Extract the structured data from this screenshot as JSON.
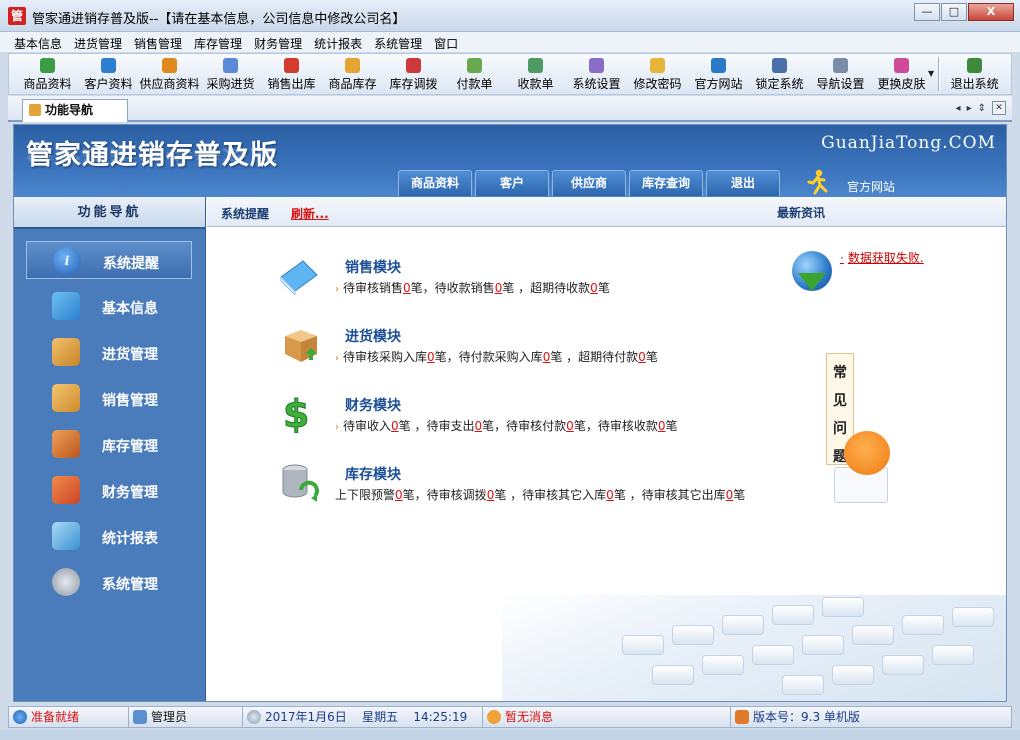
{
  "window": {
    "app_icon_char": "管",
    "title": "管家通进销存普及版--【请在基本信息，公司信息中修改公司名】",
    "minimize": "—",
    "maximize": "□",
    "close": "X"
  },
  "menu": [
    "基本信息",
    "进货管理",
    "销售管理",
    "库存管理",
    "财务管理",
    "统计报表",
    "系统管理",
    "窗口"
  ],
  "toolbar": [
    {
      "label": "商品资料",
      "icon": "goods-icon",
      "color": "#3d9b46"
    },
    {
      "label": "客户资料",
      "icon": "customer-icon",
      "color": "#2f7fd0"
    },
    {
      "label": "供应商资料",
      "icon": "supplier-icon",
      "color": "#e08a1e"
    },
    {
      "label": "采购进货",
      "icon": "purchase-icon",
      "color": "#5b8ad6"
    },
    {
      "label": "销售出库",
      "icon": "sales-icon",
      "color": "#d23b2d"
    },
    {
      "label": "商品库存",
      "icon": "stock-icon",
      "color": "#e3a431"
    },
    {
      "label": "库存调拨",
      "icon": "transfer-icon",
      "color": "#cc3a3a"
    },
    {
      "label": "付款单",
      "icon": "payment-icon",
      "color": "#6aa84f"
    },
    {
      "label": "收款单",
      "icon": "receipt-icon",
      "color": "#4f9a62"
    },
    {
      "label": "系统设置",
      "icon": "settings-icon",
      "color": "#8a6cc9"
    },
    {
      "label": "修改密码",
      "icon": "password-icon",
      "color": "#e7b43c"
    },
    {
      "label": "官方网站",
      "icon": "ie-icon",
      "color": "#2a78c8"
    },
    {
      "label": "锁定系统",
      "icon": "lock-icon",
      "color": "#4b6fa8"
    },
    {
      "label": "导航设置",
      "icon": "nav-settings-icon",
      "color": "#7a8da8"
    },
    {
      "label": "更换皮肤",
      "icon": "skin-icon",
      "color": "#d04a9a"
    },
    {
      "label": "退出系统",
      "icon": "exit-icon",
      "color": "#3d8a3d"
    }
  ],
  "tabs": {
    "active": "功能导航",
    "controls": [
      "◂",
      "▸",
      "⇕",
      "✕"
    ]
  },
  "banner": {
    "title": "管家通进销存普及版",
    "domain": "GuanJiaTong.COM",
    "tabs": [
      "商品资料",
      "客户",
      "供应商",
      "库存查询",
      "退出"
    ],
    "official_link": "官方网站"
  },
  "sidebar": {
    "header": "功能导航",
    "items": [
      {
        "label": "系统提醒",
        "icon": "info-icon",
        "color": "#1f5fb5",
        "active": true
      },
      {
        "label": "基本信息",
        "icon": "cubes-icon",
        "color": "#3b9fe0"
      },
      {
        "label": "进货管理",
        "icon": "box-in-icon",
        "color": "#e0a040"
      },
      {
        "label": "销售管理",
        "icon": "box-out-icon",
        "color": "#e2a33a"
      },
      {
        "label": "库存管理",
        "icon": "house-icon",
        "color": "#d9822b"
      },
      {
        "label": "财务管理",
        "icon": "coins-icon",
        "color": "#e06a2d"
      },
      {
        "label": "统计报表",
        "icon": "chart-icon",
        "color": "#4aa3df"
      },
      {
        "label": "系统管理",
        "icon": "gears-icon",
        "color": "#9aa4b2"
      }
    ]
  },
  "content": {
    "title": "系统提醒",
    "refresh": "刷新...",
    "news_title": "最新资讯",
    "news_fail": "数据获取失败.",
    "modules": [
      {
        "title": "销售模块",
        "icon": "book-icon",
        "color": "#4aa3ef",
        "parts": [
          [
            "待审核销售",
            "0",
            "笔，"
          ],
          [
            "待收款销售",
            "0",
            "笔 ，"
          ],
          [
            "超期待收款",
            "0",
            "笔"
          ]
        ]
      },
      {
        "title": "进货模块",
        "icon": "package-icon",
        "color": "#d9a25a",
        "parts": [
          [
            "待审核采购入库",
            "0",
            "笔，"
          ],
          [
            "待付款采购入库",
            "0",
            "笔 ，"
          ],
          [
            "超期待付款",
            "0",
            "笔"
          ]
        ]
      },
      {
        "title": "财务模块",
        "icon": "dollar-icon",
        "color": "#3fae3a",
        "parts": [
          [
            "待审收入",
            "0",
            "笔 ，"
          ],
          [
            "待审支出",
            "0",
            "笔，"
          ],
          [
            "待审核付款",
            "0",
            "笔，"
          ],
          [
            "待审核收款",
            "0",
            "笔"
          ]
        ]
      },
      {
        "title": "库存模块",
        "icon": "database-icon",
        "color": "#8f9aa6",
        "parts": [
          [
            "上下限预警",
            "0",
            "笔，"
          ],
          [
            "待审核调拨",
            "0",
            "笔 ，"
          ],
          [
            "待审核其它入库",
            "0",
            "笔 ，"
          ],
          [
            "待审核其它出库",
            "0",
            "笔"
          ]
        ]
      }
    ],
    "faq": [
      "常",
      "见",
      "问",
      "题"
    ]
  },
  "status": {
    "ready": "准备就绪",
    "user": "管理员",
    "date": "2017年1月6日",
    "weekday": "星期五",
    "time": "14:25:19",
    "messages": "暂无消息",
    "version": "版本号：9.3 单机版"
  }
}
